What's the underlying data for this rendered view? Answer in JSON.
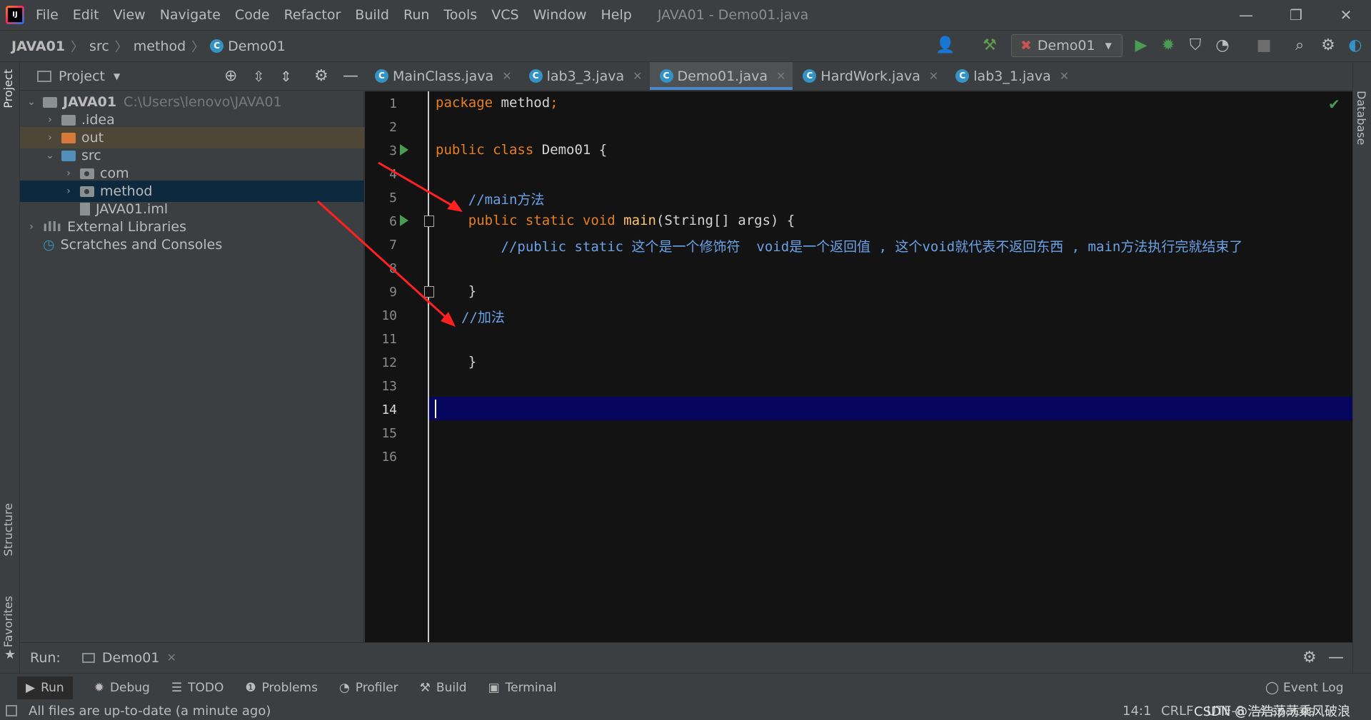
{
  "window": {
    "title": "JAVA01 - Demo01.java",
    "menu": [
      "File",
      "Edit",
      "View",
      "Navigate",
      "Code",
      "Refactor",
      "Build",
      "Run",
      "Tools",
      "VCS",
      "Window",
      "Help"
    ],
    "controls": {
      "minimize": "—",
      "restore": "❐",
      "close": "✕"
    }
  },
  "breadcrumb": {
    "project": "JAVA01",
    "folder": "src",
    "package": "method",
    "file": "Demo01"
  },
  "toolbar": {
    "run_config": "Demo01"
  },
  "project_panel": {
    "title": "Project",
    "tree": [
      {
        "label": "JAVA01",
        "hint": "C:\\Users\\lenovo\\JAVA01"
      },
      {
        "label": ".idea"
      },
      {
        "label": "out"
      },
      {
        "label": "src"
      },
      {
        "label": "com"
      },
      {
        "label": "method"
      },
      {
        "label": "JAVA01.iml"
      },
      {
        "label": "External Libraries"
      },
      {
        "label": "Scratches and Consoles"
      }
    ]
  },
  "side_tabs": {
    "project": "Project",
    "structure": "Structure",
    "favorites": "Favorites",
    "database": "Database"
  },
  "editor_tabs": [
    {
      "label": "MainClass.java"
    },
    {
      "label": "lab3_3.java"
    },
    {
      "label": "Demo01.java"
    },
    {
      "label": "HardWork.java"
    },
    {
      "label": "lab3_1.java"
    }
  ],
  "editor": {
    "line_numbers": [
      "1",
      "2",
      "3",
      "4",
      "5",
      "6",
      "7",
      "8",
      "9",
      "10",
      "11",
      "12",
      "13",
      "14",
      "15",
      "16"
    ],
    "current_line": "14"
  },
  "run_panel": {
    "label": "Run:",
    "config": "Demo01"
  },
  "bottom_tabs": [
    {
      "label": "Run",
      "icon": "play-icon"
    },
    {
      "label": "Debug",
      "icon": "bug-icon"
    },
    {
      "label": "TODO",
      "icon": "list-icon"
    },
    {
      "label": "Problems",
      "icon": "warning-icon"
    },
    {
      "label": "Profiler",
      "icon": "profiler-icon"
    },
    {
      "label": "Build",
      "icon": "hammer-icon"
    },
    {
      "label": "Terminal",
      "icon": "terminal-icon"
    }
  ],
  "event_log": "Event Log",
  "status": {
    "message": "All files are up-to-date (a minute ago)",
    "position": "14:1",
    "line_sep": "CRLF",
    "encoding": "UTF-8",
    "indent": "4 spaces",
    "watermark": "CSDN @浩浩荡荡乘风破浪"
  },
  "colors": {
    "accent": "#4a88c7",
    "arrow": "#ff2020",
    "current_line": "#06065e",
    "run_green": "#499c54"
  }
}
